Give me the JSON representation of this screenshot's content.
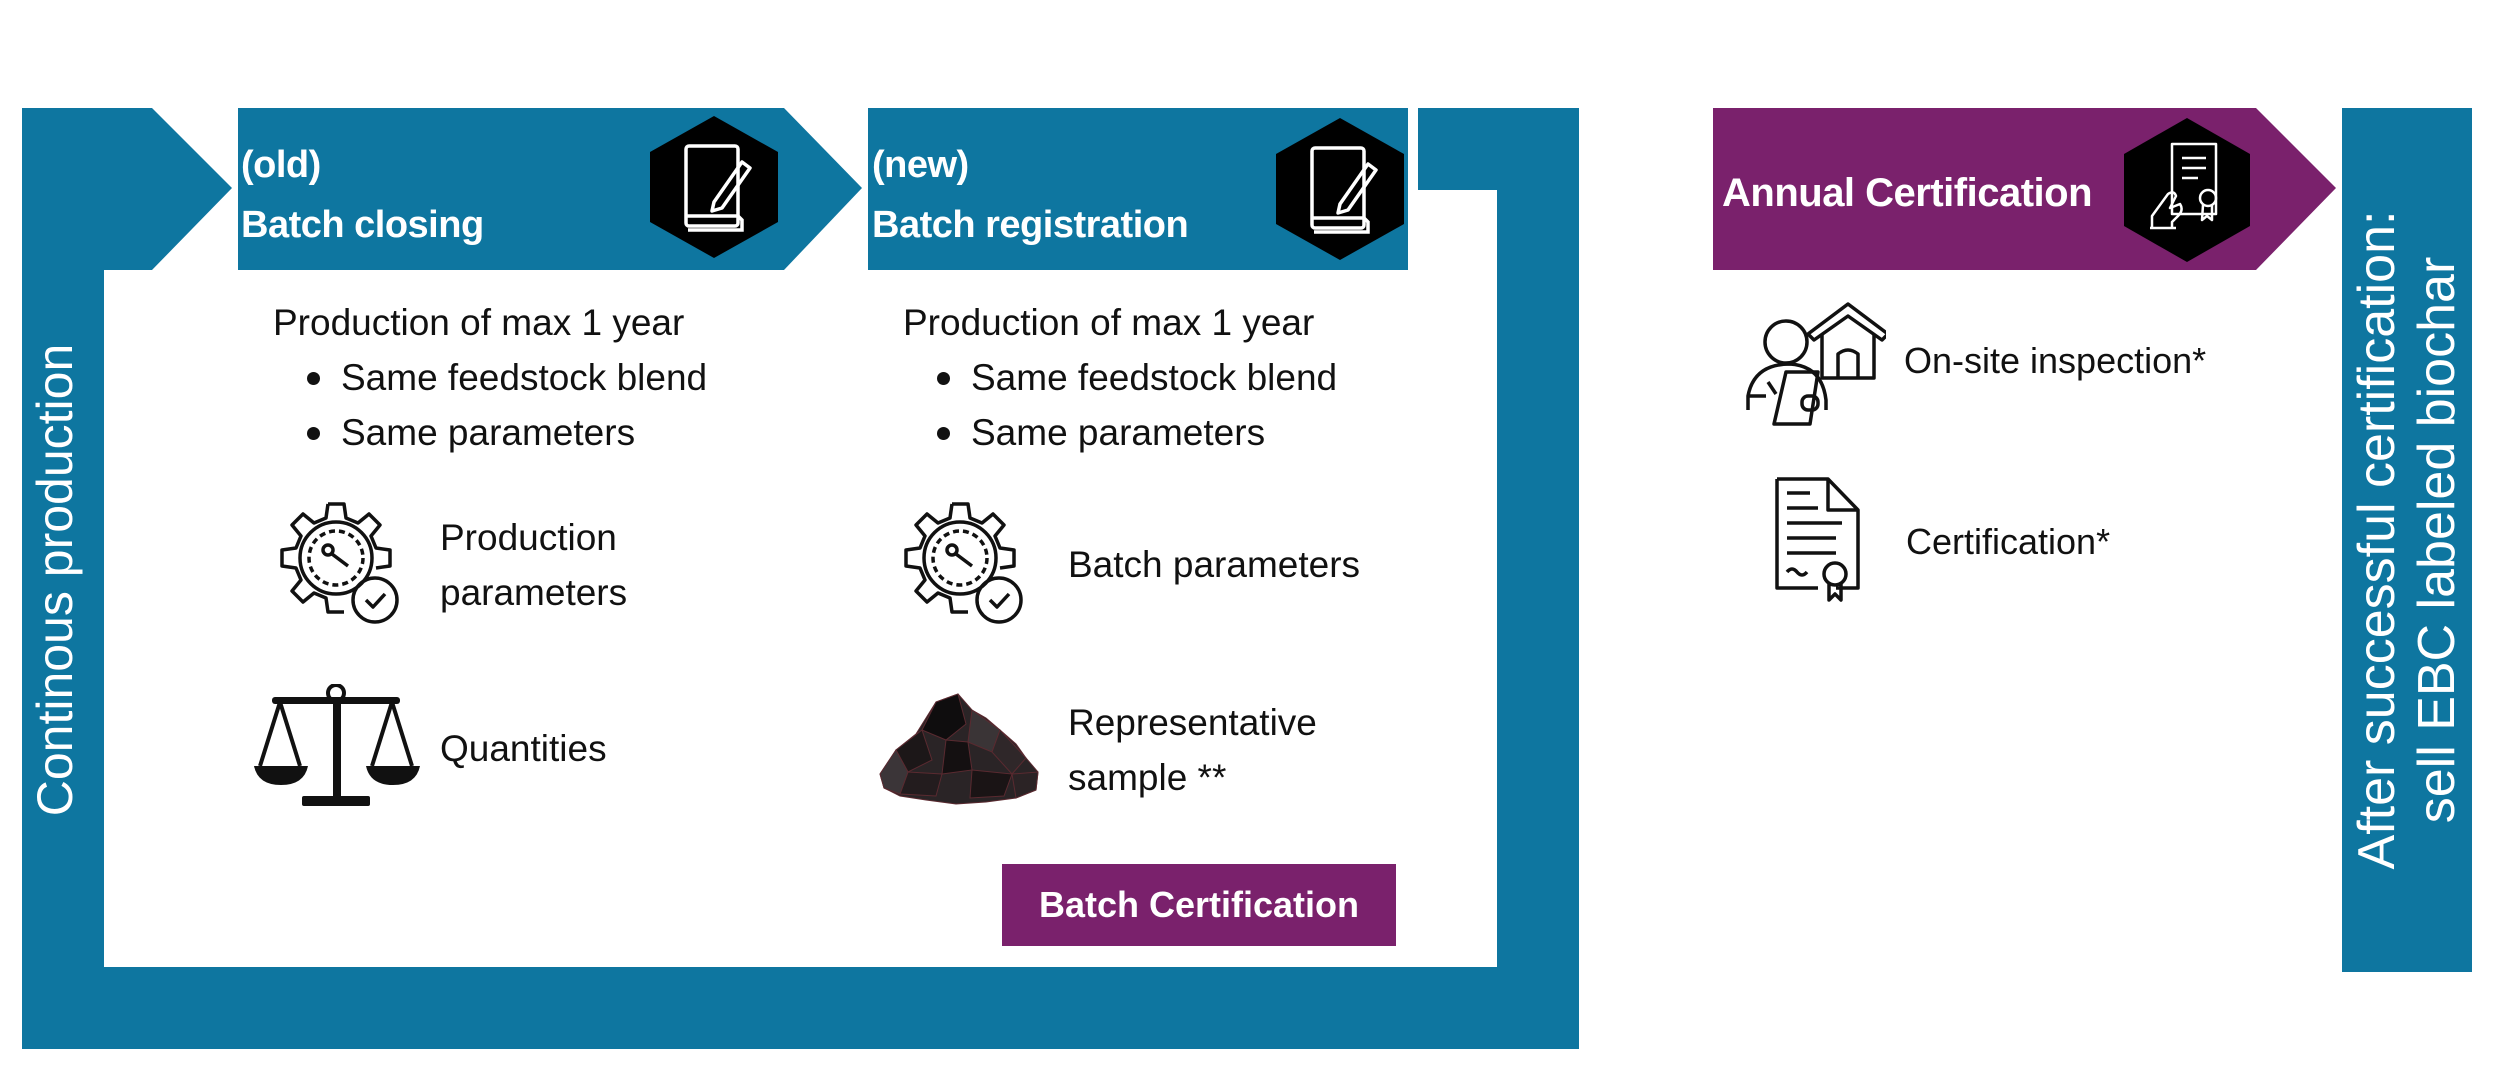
{
  "colors": {
    "primary_blue": "#0e76a0",
    "accent_purple": "#7a216c",
    "hex_black": "#000000",
    "text": "#111111",
    "background": "#ffffff"
  },
  "loop": {
    "side_label": "Continous production"
  },
  "steps": [
    {
      "tag": "(old)",
      "title": "Batch closing",
      "icon": "notebook-pen-icon",
      "intro": "Production of max 1 year",
      "bullets": [
        "Same feedstock blend",
        "Same parameters"
      ],
      "items": [
        {
          "icon": "gear-gauge-check-icon",
          "lines": [
            "Production",
            "parameters"
          ]
        },
        {
          "icon": "balance-scale-icon",
          "lines": [
            "Quantities"
          ]
        }
      ]
    },
    {
      "tag": "(new)",
      "title": "Batch registration",
      "icon": "notebook-pen-icon",
      "intro": "Production of max 1 year",
      "bullets": [
        "Same feedstock blend",
        "Same parameters"
      ],
      "items": [
        {
          "icon": "gear-gauge-check-icon",
          "lines": [
            "Batch parameters"
          ]
        },
        {
          "icon": "biochar-pile-icon",
          "lines": [
            "Representative",
            "sample **"
          ]
        }
      ],
      "badge": "Batch Certification"
    }
  ],
  "annual": {
    "title": "Annual Certification",
    "icon": "certificate-hand-icon",
    "items": [
      {
        "icon": "inspector-house-icon",
        "label": "On-site inspection*"
      },
      {
        "icon": "certificate-document-icon",
        "label": "Certification*"
      }
    ]
  },
  "outcome": {
    "line1": "After successful certification:",
    "line2": "sell EBC labeled biochar"
  }
}
